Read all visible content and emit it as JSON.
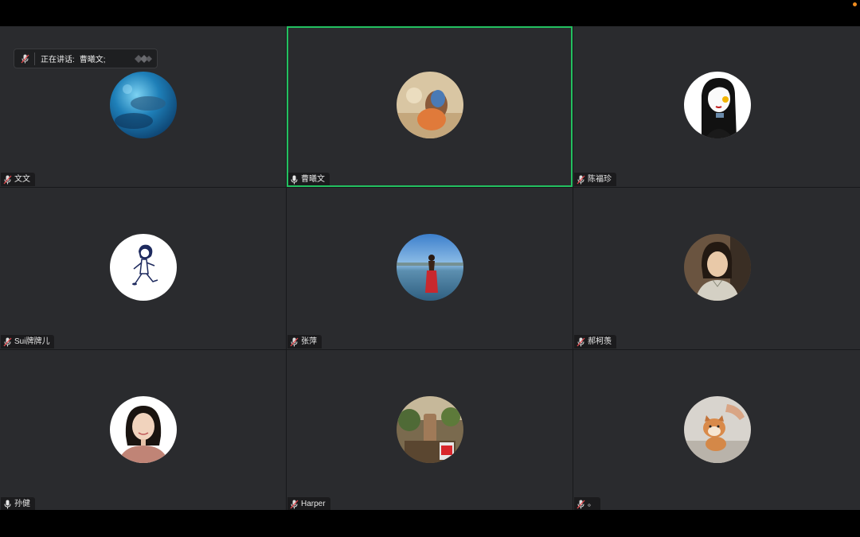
{
  "speaking_indicator": {
    "label": "正在讲话:",
    "speaker": "曹曦文;"
  },
  "participants": [
    {
      "name": "文文",
      "muted": true,
      "avatar": "ocean-photo"
    },
    {
      "name": "曹曦文",
      "muted": false,
      "avatar": "kid-photo",
      "active_speaker": true
    },
    {
      "name": "陈福珍",
      "muted": true,
      "avatar": "illustrated-woman"
    },
    {
      "name": "Sui牌牌儿",
      "muted": true,
      "avatar": "running-girl-sketch"
    },
    {
      "name": "张萍",
      "muted": true,
      "avatar": "lake-woman-photo"
    },
    {
      "name": "郝柯羡",
      "muted": true,
      "avatar": "woman-portrait"
    },
    {
      "name": "孙健",
      "muted": false,
      "avatar": "woman-professional-portrait"
    },
    {
      "name": "Harper",
      "muted": true,
      "avatar": "cafe-photo"
    },
    {
      "name": "。",
      "muted": true,
      "avatar": "shiba-puppy"
    }
  ],
  "colors": {
    "tile_bg": "#2a2b2e",
    "active_border": "#23c060",
    "muted_mic": "#e5484d",
    "status_dot": "#f08c1f"
  }
}
